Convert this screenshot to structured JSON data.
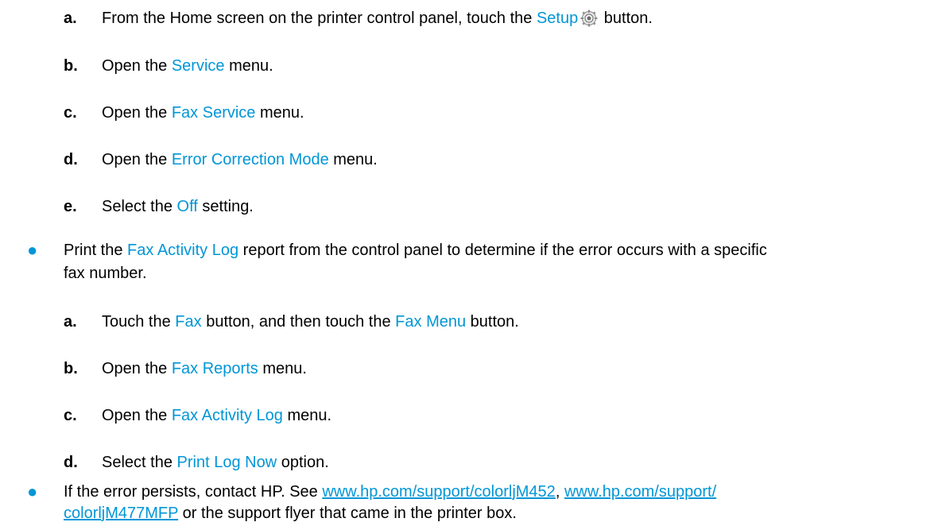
{
  "colors": {
    "highlight": "#0096d6",
    "text": "#000000"
  },
  "setup_steps": [
    {
      "letter": "a.",
      "pre": "From the Home screen on the printer control panel, touch the ",
      "hl": "Setup",
      "post": " button.",
      "icon": "gear-icon"
    },
    {
      "letter": "b.",
      "pre": "Open the ",
      "hl": "Service",
      "post": " menu."
    },
    {
      "letter": "c.",
      "pre": "Open the ",
      "hl": "Fax Service",
      "post": " menu."
    },
    {
      "letter": "d.",
      "pre": "Open the ",
      "hl": "Error Correction Mode",
      "post": " menu."
    },
    {
      "letter": "e.",
      "pre": "Select the ",
      "hl": "Off",
      "post": " setting."
    }
  ],
  "bullet_log": {
    "pre": "Print the ",
    "hl": "Fax Activity Log",
    "post_line1": " report from the control panel to determine if the error occurs with a specific",
    "line2": "fax number."
  },
  "log_steps": [
    {
      "letter": "a.",
      "pre": "Touch the ",
      "hl": "Fax",
      "mid": " button, and then touch the ",
      "hl2": "Fax Menu",
      "post": " button."
    },
    {
      "letter": "b.",
      "pre": "Open the ",
      "hl": "Fax Reports",
      "post": " menu."
    },
    {
      "letter": "c.",
      "pre": "Open the ",
      "hl": "Fax Activity Log",
      "post": " menu."
    },
    {
      "letter": "d.",
      "pre": "Select the ",
      "hl": "Print Log Now",
      "post": " option."
    }
  ],
  "bullet_contact": {
    "pre": "If the error persists, contact HP. See ",
    "link1": "www.hp.com/support/colorljM452",
    "sep": ", ",
    "link2_line1": "www.hp.com/support/",
    "link2_line2": "colorljM477MFP",
    "post": " or the support flyer that came in the printer box."
  }
}
